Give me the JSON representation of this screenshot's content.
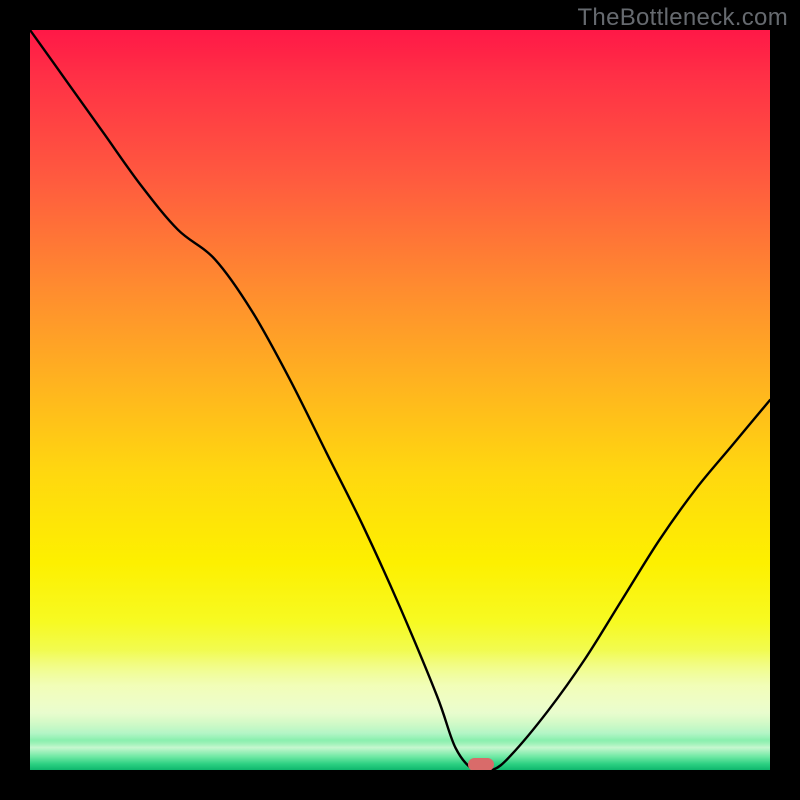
{
  "watermark": "TheBottleneck.com",
  "marker": {
    "x_frac": 0.61,
    "y_frac": 0.993
  },
  "colors": {
    "gradient_top": "#ff1847",
    "gradient_mid": "#ffd80f",
    "gradient_bottom": "#10b872",
    "curve": "#000000",
    "marker": "#d96b6a",
    "frame": "#000000"
  },
  "chart_data": {
    "type": "line",
    "title": "",
    "xlabel": "",
    "ylabel": "",
    "xlim": [
      0,
      1
    ],
    "ylim": [
      0,
      1
    ],
    "series": [
      {
        "name": "bottleneck-curve",
        "x": [
          0.0,
          0.05,
          0.1,
          0.15,
          0.2,
          0.25,
          0.3,
          0.35,
          0.4,
          0.45,
          0.5,
          0.55,
          0.575,
          0.6,
          0.625,
          0.65,
          0.7,
          0.75,
          0.8,
          0.85,
          0.9,
          0.95,
          1.0
        ],
        "y": [
          1.0,
          0.93,
          0.86,
          0.79,
          0.73,
          0.69,
          0.62,
          0.53,
          0.43,
          0.33,
          0.22,
          0.1,
          0.03,
          0.0,
          0.0,
          0.02,
          0.08,
          0.15,
          0.23,
          0.31,
          0.38,
          0.44,
          0.5
        ]
      }
    ],
    "annotations": [
      {
        "name": "optimal-marker",
        "x": 0.61,
        "y": 0.0
      }
    ]
  }
}
